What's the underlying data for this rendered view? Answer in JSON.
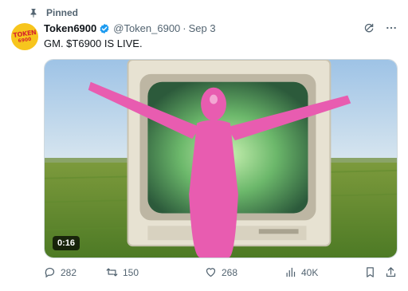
{
  "pinned_label": "Pinned",
  "author": {
    "avatar_text": "TOKEN",
    "avatar_sub": "6900",
    "name": "Token6900",
    "handle": "@Token_6900",
    "separator": "·",
    "date": "Sep 3"
  },
  "tweet": {
    "text": "GM. $T6900 IS LIVE."
  },
  "video": {
    "duration": "0:16"
  },
  "metrics": {
    "replies": "282",
    "reposts": "150",
    "likes": "268",
    "views": "40K"
  },
  "colors": {
    "text_primary": "#0f1419",
    "text_secondary": "#536471",
    "verified": "#1d9bf0",
    "avatar_bg": "#f7c51d"
  },
  "icons": {
    "pin": "pin-icon",
    "verified": "verified-badge-icon",
    "grok": "grok-icon",
    "more": "more-icon",
    "reply": "reply-icon",
    "repost": "repost-icon",
    "like": "heart-icon",
    "views": "views-icon",
    "bookmark": "bookmark-icon",
    "share": "share-icon"
  }
}
